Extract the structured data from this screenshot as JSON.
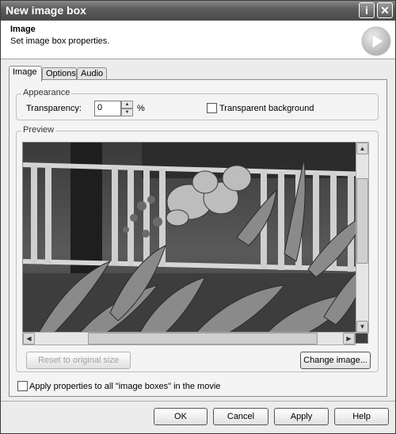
{
  "window": {
    "title": "New image box",
    "info_btn": "i",
    "close_btn": "✕"
  },
  "header": {
    "title": "Image",
    "subtitle": "Set image box properties."
  },
  "tabs": [
    {
      "label": "Image",
      "active": true
    },
    {
      "label": "Options",
      "active": false
    },
    {
      "label": "Audio",
      "active": false
    }
  ],
  "appearance": {
    "legend": "Appearance",
    "transparency_label": "Transparency:",
    "transparency_value": "0",
    "transparency_unit": "%",
    "transparent_bg_label": "Transparent background",
    "transparent_bg_checked": false
  },
  "preview": {
    "legend": "Preview",
    "reset_btn": "Reset to original size",
    "change_btn": "Change image..."
  },
  "apply_all": {
    "label": "Apply properties to all \"image boxes\" in the movie",
    "checked": false
  },
  "footer": {
    "ok": "OK",
    "cancel": "Cancel",
    "apply": "Apply",
    "help": "Help"
  }
}
